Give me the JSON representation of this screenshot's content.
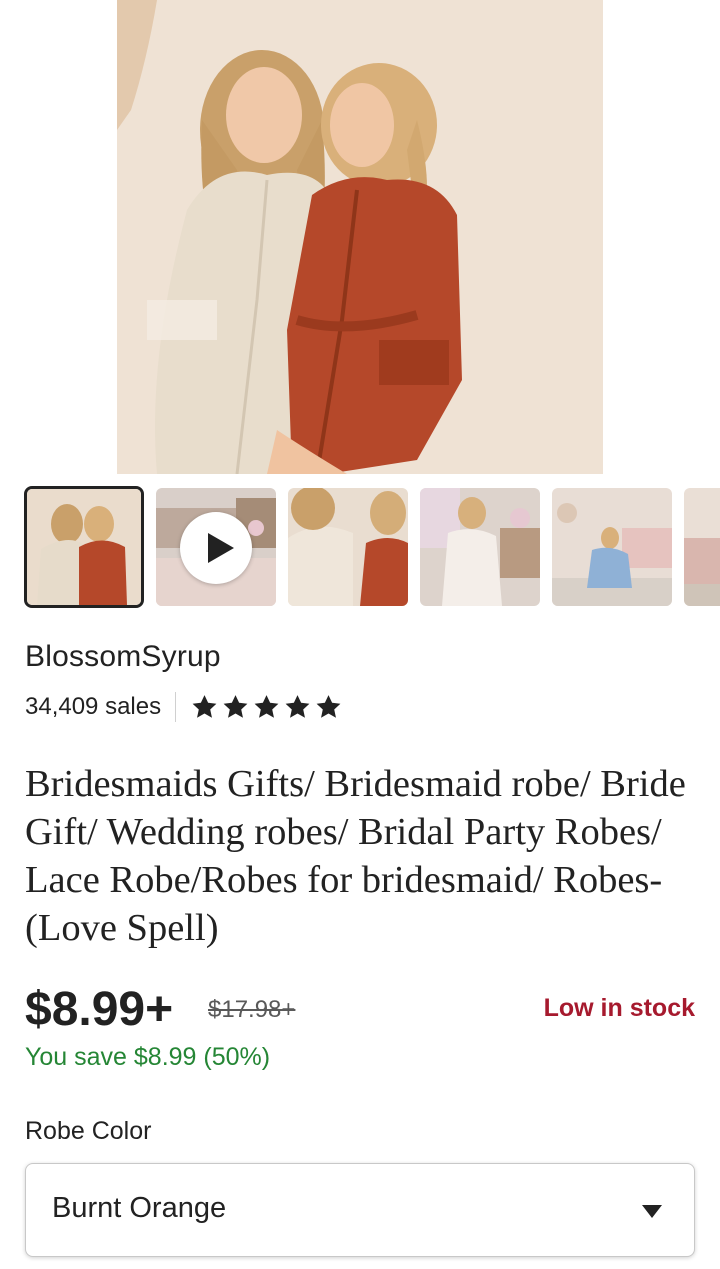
{
  "listing": {
    "shop_name": "BlossomSyrup",
    "sales": "34,409 sales",
    "rating_stars": 5,
    "title": "Bridesmaids Gifts/ Bridesmaid robe/ Bride Gift/ Wedding robes/ Bridal Party Robes/ Lace Robe/Robes for bridesmaid/ Robes- (Love Spell)",
    "price": "$8.99+",
    "original_price": "$17.98+",
    "stock_status": "Low in stock",
    "savings": "You save $8.99 (50%)"
  },
  "gallery": {
    "thumbnails": [
      {
        "kind": "photo",
        "selected": true
      },
      {
        "kind": "video",
        "selected": false
      },
      {
        "kind": "photo",
        "selected": false
      },
      {
        "kind": "photo",
        "selected": false
      },
      {
        "kind": "photo",
        "selected": false
      },
      {
        "kind": "photo",
        "selected": false
      }
    ]
  },
  "variation": {
    "label": "Robe Color",
    "selected_value": "Burnt Orange"
  },
  "colors": {
    "star": "#222222",
    "stock_red": "#a61a2e",
    "savings_green": "#258635",
    "robe_orange": "#b5482a",
    "robe_champagne": "#e9dfd0"
  }
}
